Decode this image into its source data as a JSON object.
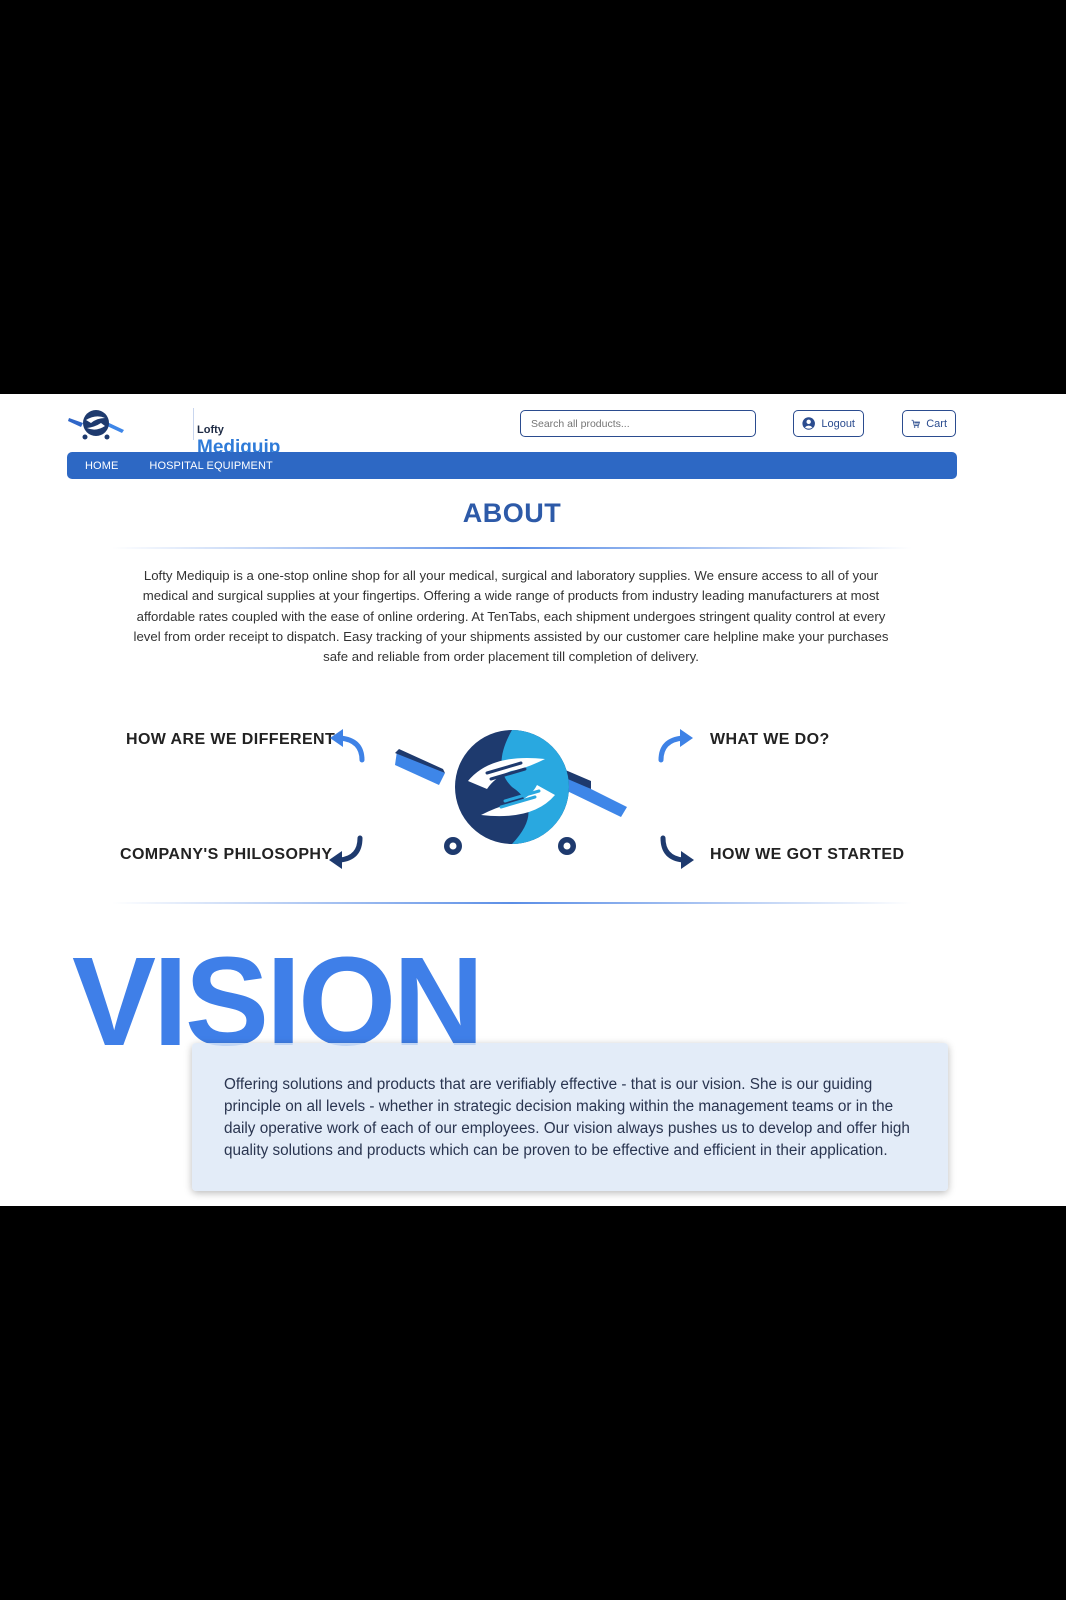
{
  "brand": {
    "small": "Lofty",
    "big": "Mediquip"
  },
  "search": {
    "placeholder": "Search all products..."
  },
  "account": {
    "logout_label": "Logout",
    "cart_label": "Cart"
  },
  "nav": {
    "items": [
      {
        "label": "HOME"
      },
      {
        "label": "HOSPITAL EQUIPMENT"
      }
    ]
  },
  "about": {
    "title": "ABOUT",
    "text": "Lofty Mediquip is a one-stop online shop for all your medical, surgical and laboratory supplies. We ensure access to all of your medical and surgical supplies at your fingertips. Offering a wide range of products from industry leading manufacturers at most affordable rates coupled with the ease of online ordering. At TenTabs, each shipment undergoes stringent quality control at every level from order receipt to dispatch. Easy tracking of your shipments assisted by our customer care helpline make your purchases safe and reliable from order placement till completion of delivery."
  },
  "features": {
    "different": "HOW ARE WE DIFFERENT",
    "what": "WHAT WE DO?",
    "philosophy": "COMPANY'S PHILOSOPHY",
    "started": "HOW WE GOT STARTED"
  },
  "vision": {
    "heading": "VISION",
    "text": "Offering solutions and products that are verifiably effective - that is our vision. She is our guiding principle on all levels - whether in strategic decision making within the management teams or in the daily operative work of each of our employees. Our vision always pushes us to develop and offer high quality solutions and products which can be proven to be effective and efficient in their application."
  },
  "colors": {
    "primary": "#2d68c4",
    "accent": "#3f7fe8",
    "dark": "#1e3a6e",
    "light": "#29a8e0"
  }
}
